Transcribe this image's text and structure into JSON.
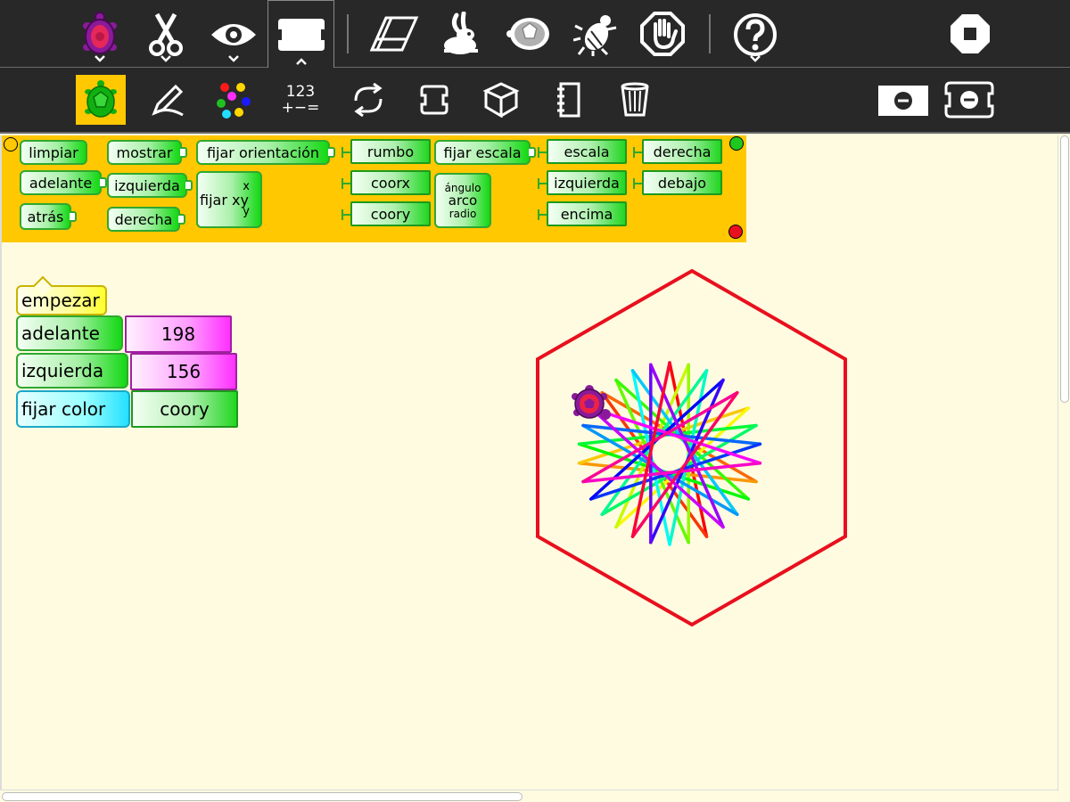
{
  "toolbar_top": {
    "icons": [
      "turtle-activity-icon",
      "scissors-icon",
      "eye-icon",
      "blocks-tab-icon",
      "eraser-icon",
      "rabbit-icon",
      "turtle-shell-icon",
      "bug-icon",
      "stop-hand-icon",
      "help-icon",
      "stop-icon"
    ]
  },
  "toolbar_bottom": {
    "numbers_label": "123\n+−=",
    "icons": [
      "turtle-palette-icon",
      "pen-icon",
      "colors-icon",
      "numbers-icon",
      "flow-icon",
      "blocks-icon",
      "extras-icon",
      "media-icon",
      "trash-icon",
      "collapse-icon",
      "collapse-stack-icon"
    ]
  },
  "palette": {
    "turtle": {
      "clear": "limpiar",
      "forward": "adelante",
      "back": "atrás",
      "show": "mostrar",
      "left": "izquierda",
      "right": "derecha",
      "set_heading": "fijar orientación",
      "set_xy": "fijar xy",
      "set_xy_x": "x",
      "set_xy_y": "y",
      "heading": "rumbo",
      "xcor": "coorx",
      "ycor": "coory",
      "set_scale": "fijar escala",
      "arc": "arco",
      "arc_angle": "ángulo",
      "arc_radius": "radio",
      "scale": "escala",
      "left_edge": "izquierda",
      "top_edge": "encima",
      "right_edge": "derecha",
      "bottom_edge": "debajo"
    }
  },
  "program": {
    "start": "empezar",
    "forward": "adelante",
    "forward_value": "198",
    "left": "izquierda",
    "left_value": "156",
    "set_color": "fijar color",
    "set_color_value": "coory"
  },
  "colors": {
    "toolbar_bg": "#282828",
    "palette_bg": "#ffc800",
    "canvas_bg": "#fffbe0",
    "hexagon": "#e8101e"
  }
}
